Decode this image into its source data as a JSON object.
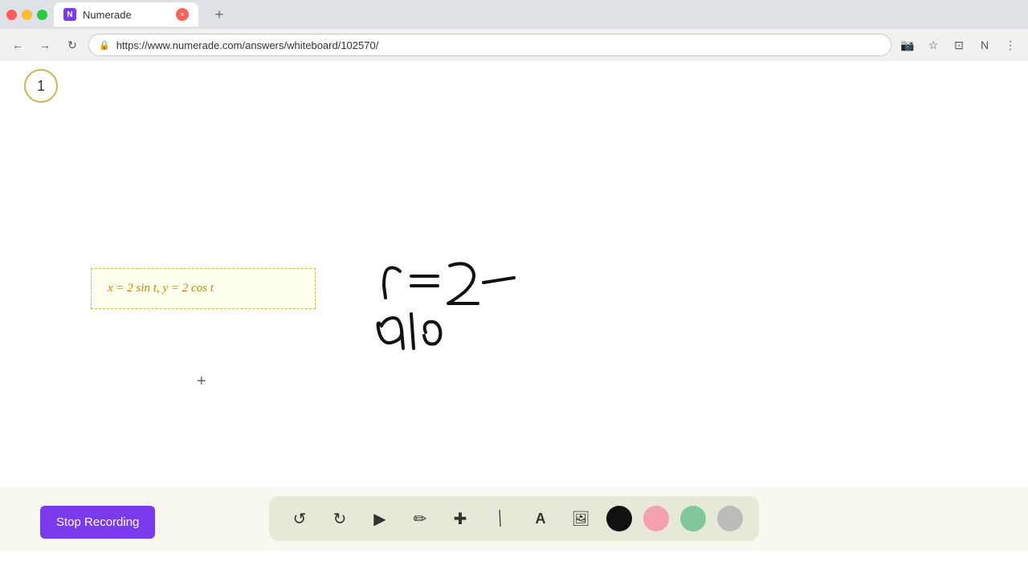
{
  "browser": {
    "tab_title": "Numerade",
    "tab_url": "https://www.numerade.com/answers/whiteboard/102570/",
    "new_tab_label": "+",
    "back_btn": "←",
    "forward_btn": "→",
    "refresh_btn": "↻"
  },
  "slide": {
    "slide_number": "1",
    "question_text": "x = 2 sin t,    y = 2 cos t"
  },
  "toolbar": {
    "undo_label": "↺",
    "redo_label": "↻",
    "select_label": "▲",
    "pen_label": "✏",
    "add_label": "+",
    "eraser_label": "/",
    "text_label": "A",
    "image_label": "🖼",
    "colors": [
      "#111111",
      "#f4a0b0",
      "#80c89a",
      "#bbbbbb"
    ]
  },
  "recording": {
    "stop_label": "Stop Recording"
  }
}
